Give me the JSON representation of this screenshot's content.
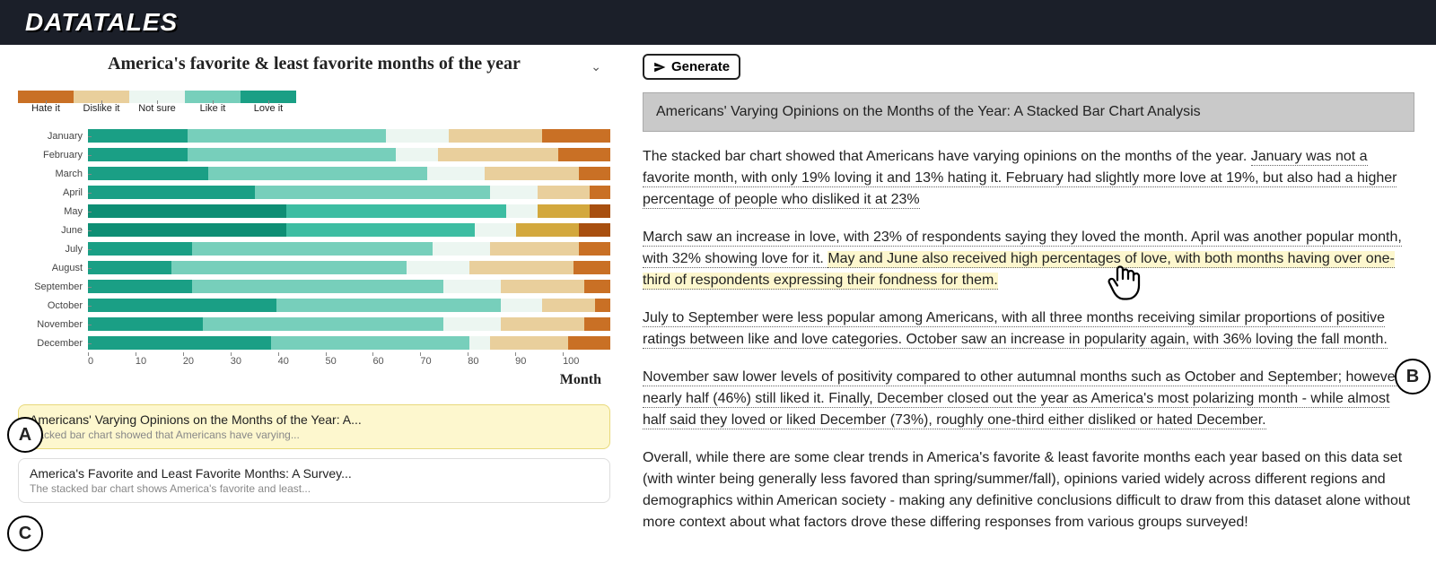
{
  "app": {
    "logo": "DATATALES"
  },
  "chart_data": {
    "type": "bar",
    "stacked": true,
    "orientation": "horizontal",
    "title": "America's favorite & least favorite months of the year",
    "xlabel": "Month",
    "xlim": [
      0,
      100
    ],
    "x_ticks": [
      "0",
      "10",
      "20",
      "30",
      "40",
      "50",
      "60",
      "70",
      "80",
      "90",
      "100"
    ],
    "legend": [
      "Hate it",
      "Dislike it",
      "Not sure",
      "Like it",
      "Love it"
    ],
    "legend_colors": {
      "Love it": "#1a9f85",
      "Like it": "#77cfbb",
      "Not sure": "#ecf6f1",
      "Dislike it": "#e9cf9c",
      "Hate it": "#c97025"
    },
    "categories": [
      "January",
      "February",
      "March",
      "April",
      "May",
      "June",
      "July",
      "August",
      "September",
      "October",
      "November",
      "December"
    ],
    "series": [
      {
        "name": "Love it",
        "values": [
          19,
          19,
          23,
          32,
          38,
          38,
          20,
          16,
          20,
          36,
          22,
          35
        ]
      },
      {
        "name": "Like it",
        "values": [
          38,
          40,
          42,
          45,
          42,
          36,
          46,
          45,
          48,
          43,
          46,
          38
        ]
      },
      {
        "name": "Not sure",
        "values": [
          12,
          8,
          11,
          9,
          6,
          8,
          11,
          12,
          11,
          8,
          11,
          4
        ]
      },
      {
        "name": "Dislike it",
        "values": [
          18,
          23,
          18,
          10,
          10,
          12,
          17,
          20,
          16,
          10,
          16,
          15
        ]
      },
      {
        "name": "Hate it",
        "values": [
          13,
          10,
          6,
          4,
          4,
          6,
          6,
          7,
          5,
          3,
          5,
          8
        ]
      }
    ],
    "highlight_rows": [
      "May",
      "June"
    ]
  },
  "buttons": {
    "generate": "Generate"
  },
  "narrative": {
    "title": "Americans' Varying Opinions on the Months of the Year: A Stacked Bar Chart Analysis",
    "p1_a": "The stacked bar chart showed that Americans have varying opinions on the months of the year. ",
    "p1_b": "January was not a favorite month, with only 19% loving it and 13% hating it. February had slightly more love at 19%, but also had a higher percentage of people who disliked it at 23%",
    "p2_a": "March saw an increase in love, with 23% of respondents saying they loved the month. April was another popular month, with 32% showing love for it. ",
    "p2_b": "May and June also received high percentages of love, with both months having over one-third of respondents expressing their fondness for them.",
    "p3_a": "July to September were less popular among Americans, with all three months receiving similar proportions of positive ratings between like and love categories. October saw an increase in popularity again, with 36% loving the fall month.",
    "p4_a": "November saw lower levels of positivity compared to other autumnal months such as October and September; however nearly half (46%) still liked it. Finally, December closed out the year as America's most polarizing month - while almost half said they loved or liked December (73%), roughly one-third either disliked or hated December.",
    "p5": "Overall, while there are some clear trends in America's favorite & least favorite months each year based on this data set (with winter being generally less favored than spring/summer/fall), opinions varied widely across different regions and demographics within American society - making any definitive conclusions difficult to draw from this dataset alone without more context about what factors drove these differing responses from various groups surveyed!"
  },
  "cards": [
    {
      "title": "Americans' Varying Opinions on the Months of the Year: A...",
      "sub": "stacked bar chart showed that Americans have varying...",
      "active": true
    },
    {
      "title": "America's Favorite and Least Favorite Months: A Survey...",
      "sub": "The stacked bar chart shows America's favorite and least...",
      "active": false
    }
  ],
  "labels": {
    "A": "A",
    "B": "B",
    "C": "C"
  }
}
